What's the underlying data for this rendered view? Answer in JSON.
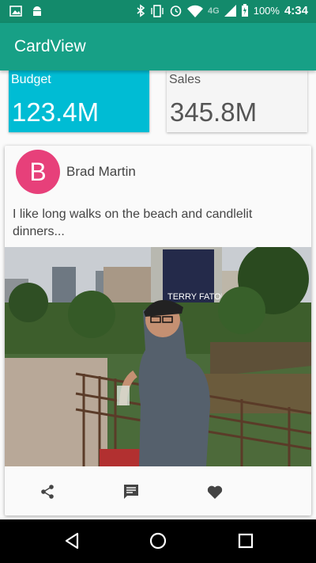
{
  "status_bar": {
    "network_label": "4G",
    "battery": "100%",
    "time": "4:34",
    "icons": [
      "image-icon",
      "android-icon",
      "bluetooth-icon",
      "vibrate-icon",
      "alarm-icon",
      "wifi-icon",
      "signal-icon",
      "battery-icon"
    ]
  },
  "app_bar": {
    "title": "CardView"
  },
  "stats": {
    "budget": {
      "label": "Budget",
      "value": "123.4M"
    },
    "sales": {
      "label": "Sales",
      "value": "345.8M"
    }
  },
  "profile": {
    "avatar_letter": "B",
    "name": "Brad Martin",
    "bio": "I like long walks on the beach and candlelit dinners...",
    "photo_sign_text": "TERRY FATOR"
  },
  "actions": {
    "icons": [
      "share-icon",
      "comment-icon",
      "heart-icon"
    ]
  },
  "nav": {
    "icons": [
      "back-icon",
      "home-icon",
      "recents-icon"
    ]
  },
  "colors": {
    "status_bar": "#138a6b",
    "app_bar": "#17a086",
    "budget_card": "#00bcd4",
    "avatar": "#e7407a"
  }
}
